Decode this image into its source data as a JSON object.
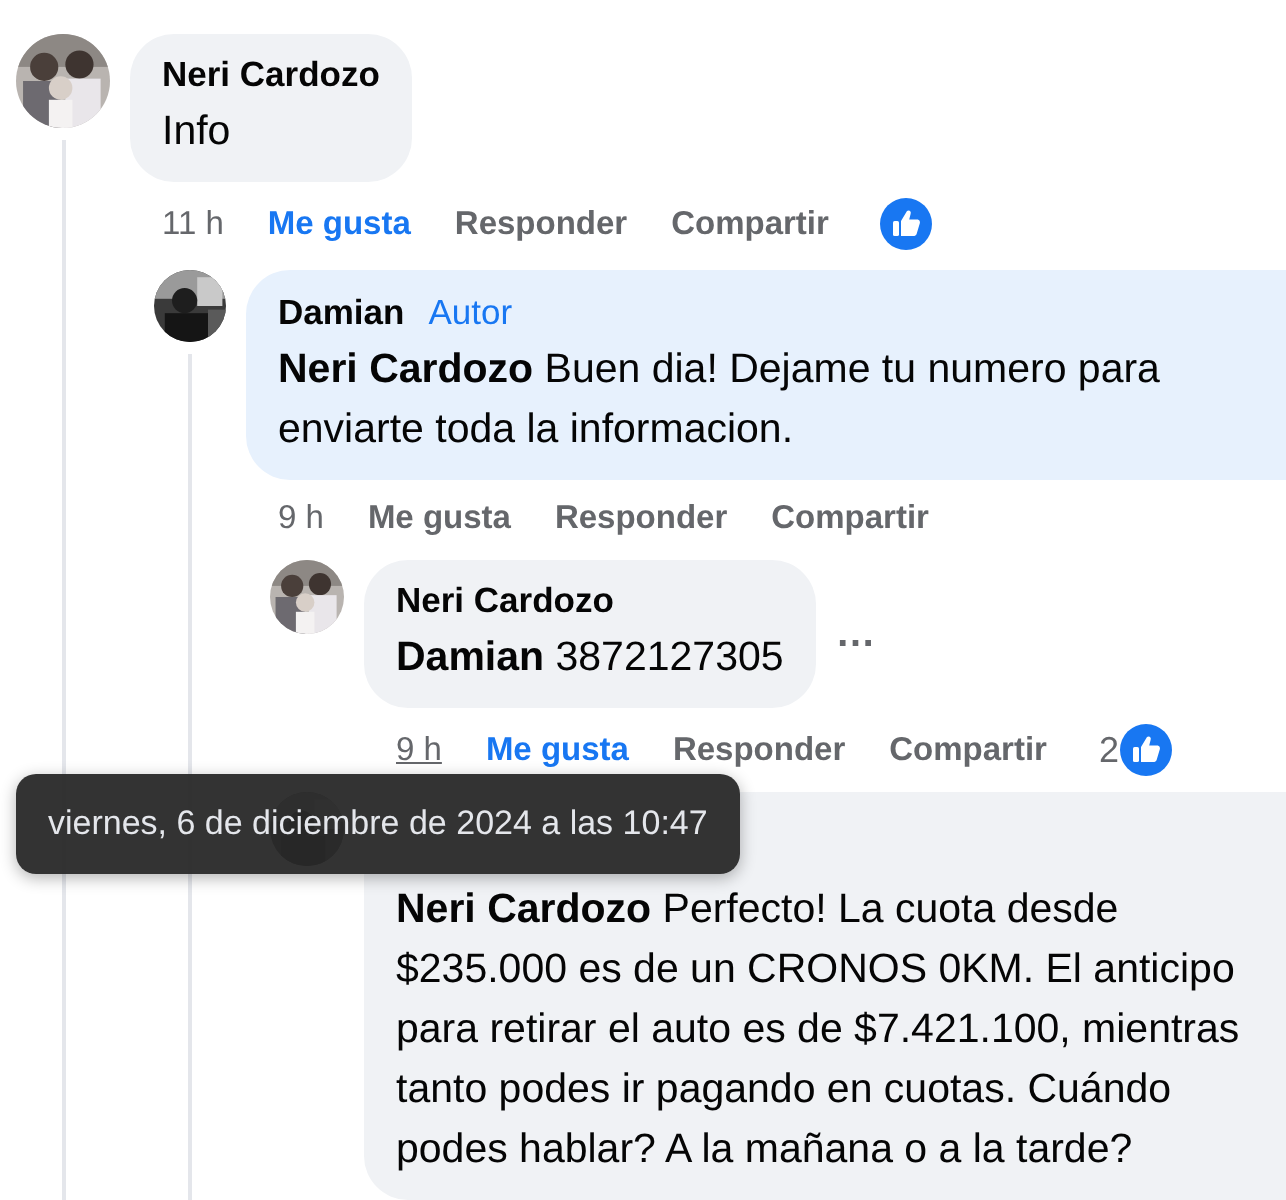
{
  "comments": [
    {
      "author": "Neri Cardozo",
      "avatar": {
        "kind": "picture"
      },
      "text": "Info",
      "time": "11 h",
      "time_hovered": false,
      "like": "Me gusta",
      "liked": true,
      "reply": "Responder",
      "share": "Compartir",
      "reaction_icon": true,
      "children": [
        {
          "author": "Damian",
          "badge": "Autor",
          "avatar": {
            "kind": "picture"
          },
          "highlighted": true,
          "mention": "Neri Cardozo",
          "text": "Buen dia! Dejame tu numero para enviarte toda la informacion.",
          "time": "9 h",
          "time_hovered": false,
          "like": "Me gusta",
          "liked": false,
          "reply": "Responder",
          "share": "Compartir",
          "children": [
            {
              "author": "Neri Cardozo",
              "avatar": {
                "kind": "picture"
              },
              "mention": "Damian",
              "text": "3872127305",
              "more": "…",
              "time": "9 h",
              "time_hovered": true,
              "like": "Me gusta",
              "liked": true,
              "reply": "Responder",
              "share": "Compartir",
              "reaction_count": "2",
              "reaction_icon": true
            },
            {
              "avatar": {
                "kind": "picture"
              },
              "mention": "Neri Cardozo",
              "text": "Perfecto! La cuota desde $235.000 es de un CRONOS 0KM. El anticipo para retirar el auto es de $7.421.100, mientras tanto podes ir pagando en cuotas. Cuándo podes hablar? A la mañana o a la tarde?"
            }
          ]
        }
      ]
    }
  ],
  "tooltip": {
    "text": "viernes, 6 de diciembre de 2024 a las 10:47"
  }
}
